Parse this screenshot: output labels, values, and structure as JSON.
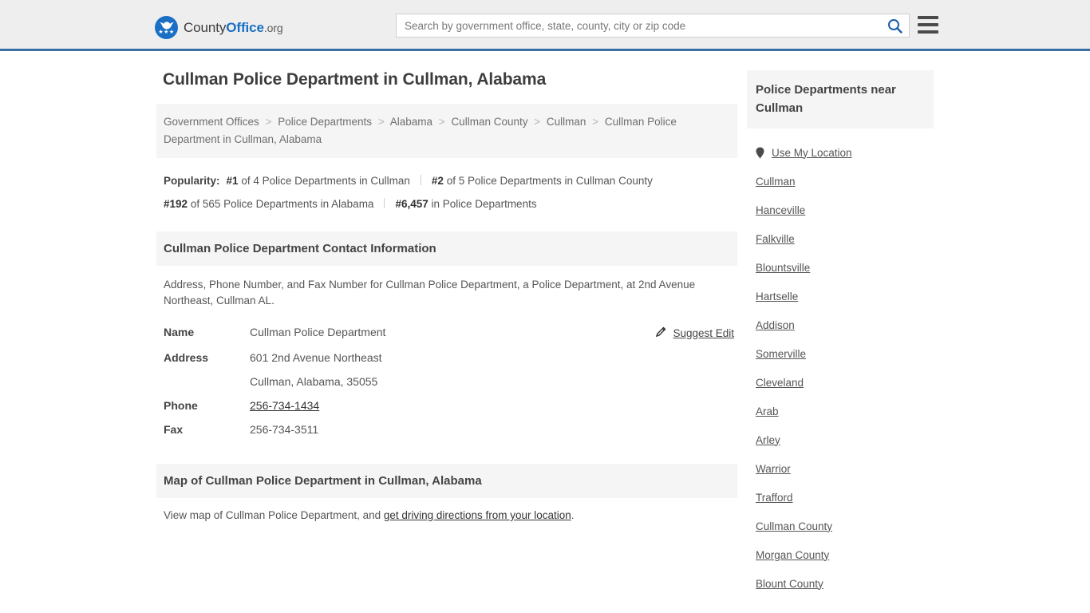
{
  "header": {
    "brand": {
      "name_part1": "County",
      "name_part2": "Office",
      "name_part3": ".org",
      "logo_icon": "eagle-circle-logo",
      "stars": "★★★"
    },
    "search": {
      "placeholder": "Search by government office, state, county, city or zip code",
      "value": "",
      "search_icon": "search-icon"
    },
    "menu_icon": "hamburger-menu-icon",
    "accent_color": "#3a6ea5"
  },
  "main": {
    "title": "Cullman Police Department in Cullman, Alabama",
    "breadcrumb": [
      "Government Offices",
      "Police Departments",
      "Alabama",
      "Cullman County",
      "Cullman",
      "Cullman Police Department in Cullman, Alabama"
    ],
    "popularity": {
      "label": "Popularity:",
      "items": [
        {
          "rank": "#1",
          "text": "of 4 Police Departments in Cullman"
        },
        {
          "rank": "#2",
          "text": "of 5 Police Departments in Cullman County"
        },
        {
          "rank": "#192",
          "text": "of 565 Police Departments in Alabama"
        },
        {
          "rank": "#6,457",
          "text": "in Police Departments"
        }
      ]
    },
    "contact": {
      "heading": "Cullman Police Department Contact Information",
      "description": "Address, Phone Number, and Fax Number for Cullman Police Department, a Police Department, at 2nd Avenue Northeast, Cullman AL.",
      "suggest_edit": "Suggest Edit",
      "suggest_edit_icon": "edit-pencil-icon",
      "rows": [
        {
          "key": "Name",
          "value": "Cullman Police Department"
        },
        {
          "key": "Address",
          "value": "601 2nd Avenue Northeast"
        },
        {
          "key": "",
          "value": "Cullman, Alabama, 35055"
        },
        {
          "key": "Phone",
          "value": "256-734-1434"
        },
        {
          "key": "Fax",
          "value": "256-734-3511"
        }
      ]
    },
    "map": {
      "heading": "Map of Cullman Police Department in Cullman, Alabama",
      "note_prefix": "View map of Cullman Police Department, and ",
      "note_link": "get driving directions from your location",
      "note_suffix": "."
    }
  },
  "sidebar": {
    "heading": "Police Departments near Cullman",
    "use_my_location": "Use My Location",
    "location_icon": "map-pin-icon",
    "items": [
      {
        "label": "Cullman"
      },
      {
        "label": "Hanceville"
      },
      {
        "label": "Falkville"
      },
      {
        "label": "Blountsville"
      },
      {
        "label": "Hartselle"
      },
      {
        "label": "Addison"
      },
      {
        "label": "Somerville"
      },
      {
        "label": "Cleveland"
      },
      {
        "label": "Arab"
      },
      {
        "label": "Arley"
      },
      {
        "label": "Warrior"
      },
      {
        "label": "Trafford"
      },
      {
        "label": "Cullman County"
      },
      {
        "label": "Morgan County"
      },
      {
        "label": "Blount County"
      }
    ]
  }
}
